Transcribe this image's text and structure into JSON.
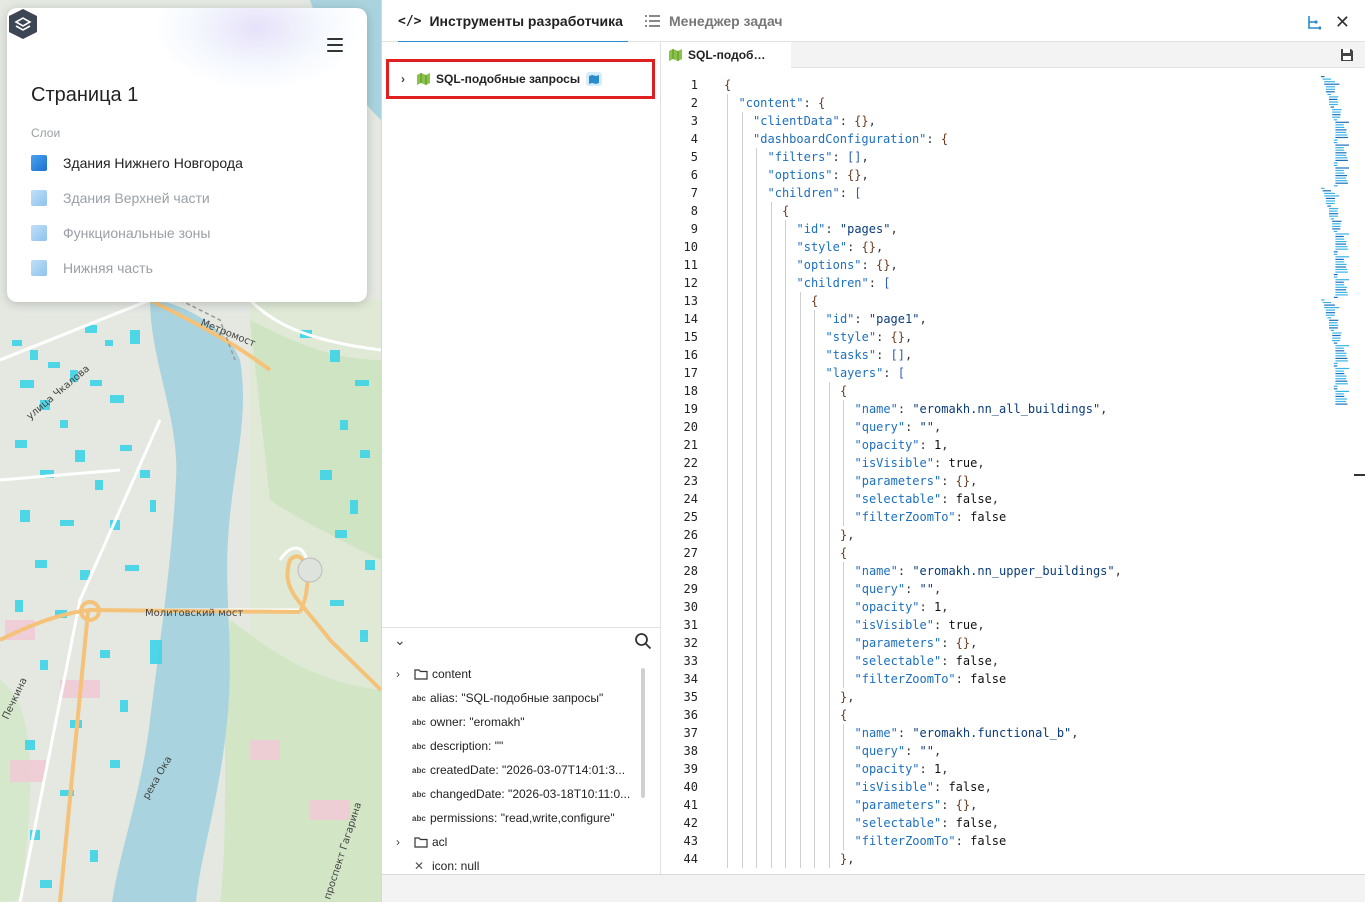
{
  "map": {
    "street_labels": [
      "Метромост",
      "улица Чкалова",
      "Молитовский мост",
      "проспект Гагарина",
      "Печкина",
      "река Ока"
    ]
  },
  "layers_panel": {
    "page_title": "Страница 1",
    "layers_caption": "Слои",
    "layers": [
      {
        "label": "Здания Нижнего Новгорода",
        "active": true,
        "color": "#1a73d9"
      },
      {
        "label": "Здания Верхней части",
        "active": false,
        "color": "#a5cdf2"
      },
      {
        "label": "Функциональные зоны",
        "active": false,
        "color": "#a5cdf2"
      },
      {
        "label": "Нижняя часть",
        "active": false,
        "color": "#a5cdf2"
      }
    ]
  },
  "devtools": {
    "tabs": [
      {
        "label": "Инструменты разработчика",
        "icon": "code-icon"
      },
      {
        "label": "Менеджер задач",
        "icon": "list-icon"
      }
    ],
    "tree_root_label": "SQL-подобные запросы",
    "file_tab_label": "SQL-подоб…",
    "properties": [
      {
        "kind": "folder",
        "text": "content"
      },
      {
        "kind": "abc",
        "text": "alias: \"SQL-подобные запросы\""
      },
      {
        "kind": "abc",
        "text": "owner: \"eromakh\""
      },
      {
        "kind": "abc",
        "text": "description: \"\""
      },
      {
        "kind": "abc",
        "text": "createdDate: \"2026-03-07T14:01:3..."
      },
      {
        "kind": "abc",
        "text": "changedDate: \"2026-03-18T10:11:0..."
      },
      {
        "kind": "abc",
        "text": "permissions: \"read,write,configure\""
      },
      {
        "kind": "folder",
        "text": "acl"
      },
      {
        "kind": "null",
        "text": "icon: null"
      }
    ]
  },
  "code_lines": [
    [
      0,
      "{"
    ],
    [
      1,
      "\"content\": {"
    ],
    [
      2,
      "\"clientData\": {},"
    ],
    [
      2,
      "\"dashboardConfiguration\": {"
    ],
    [
      3,
      "\"filters\": [],"
    ],
    [
      3,
      "\"options\": {},"
    ],
    [
      3,
      "\"children\": ["
    ],
    [
      4,
      "{"
    ],
    [
      5,
      "\"id\": \"pages\","
    ],
    [
      5,
      "\"style\": {},"
    ],
    [
      5,
      "\"options\": {},"
    ],
    [
      5,
      "\"children\": ["
    ],
    [
      6,
      "{"
    ],
    [
      7,
      "\"id\": \"page1\","
    ],
    [
      7,
      "\"style\": {},"
    ],
    [
      7,
      "\"tasks\": [],"
    ],
    [
      7,
      "\"layers\": ["
    ],
    [
      8,
      "{"
    ],
    [
      9,
      "\"name\": \"eromakh.nn_all_buildings\","
    ],
    [
      9,
      "\"query\": \"\","
    ],
    [
      9,
      "\"opacity\": 1,"
    ],
    [
      9,
      "\"isVisible\": true,"
    ],
    [
      9,
      "\"parameters\": {},"
    ],
    [
      9,
      "\"selectable\": false,"
    ],
    [
      9,
      "\"filterZoomTo\": false"
    ],
    [
      8,
      "},"
    ],
    [
      8,
      "{"
    ],
    [
      9,
      "\"name\": \"eromakh.nn_upper_buildings\","
    ],
    [
      9,
      "\"query\": \"\","
    ],
    [
      9,
      "\"opacity\": 1,"
    ],
    [
      9,
      "\"isVisible\": true,"
    ],
    [
      9,
      "\"parameters\": {},"
    ],
    [
      9,
      "\"selectable\": false,"
    ],
    [
      9,
      "\"filterZoomTo\": false"
    ],
    [
      8,
      "},"
    ],
    [
      8,
      "{"
    ],
    [
      9,
      "\"name\": \"eromakh.functional_b\","
    ],
    [
      9,
      "\"query\": \"\","
    ],
    [
      9,
      "\"opacity\": 1,"
    ],
    [
      9,
      "\"isVisible\": false,"
    ],
    [
      9,
      "\"parameters\": {},"
    ],
    [
      9,
      "\"selectable\": false,"
    ],
    [
      9,
      "\"filterZoomTo\": false"
    ],
    [
      8,
      "},"
    ]
  ]
}
